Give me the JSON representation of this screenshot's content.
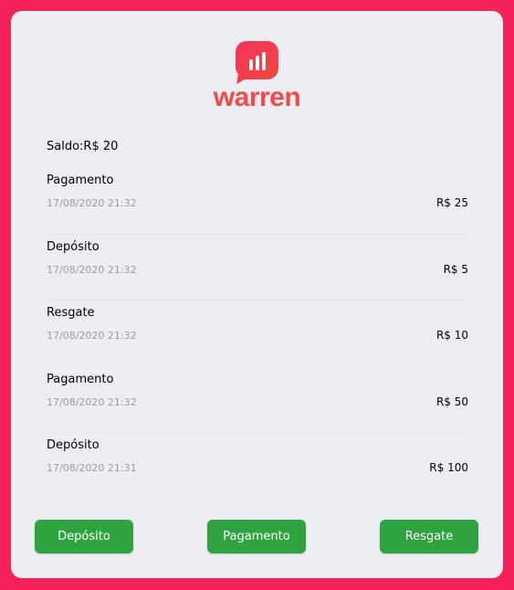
{
  "brand": {
    "name": "warren",
    "logo_icon": "bar-chart-bubble-icon",
    "color": "#f2494a",
    "background": "#f5225a"
  },
  "balance": {
    "label": "Saldo:R$ 20"
  },
  "transactions": [
    {
      "type": "Pagamento",
      "date": "17/08/2020 21:32",
      "amount": "R$ 25"
    },
    {
      "type": "Depósito",
      "date": "17/08/2020 21:32",
      "amount": "R$ 5"
    },
    {
      "type": "Resgate",
      "date": "17/08/2020 21:32",
      "amount": "R$ 10"
    },
    {
      "type": "Pagamento",
      "date": "17/08/2020 21:32",
      "amount": "R$ 50"
    },
    {
      "type": "Depósito",
      "date": "17/08/2020 21:31",
      "amount": "R$ 100"
    }
  ],
  "actions": {
    "deposit_label": "Depósito",
    "payment_label": "Pagamento",
    "withdraw_label": "Resgate",
    "button_color": "#2fa340"
  }
}
